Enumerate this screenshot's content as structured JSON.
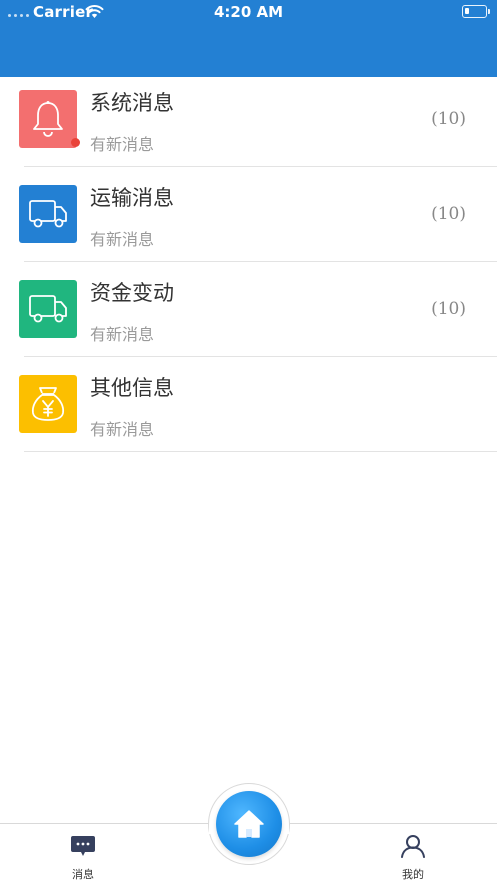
{
  "status_bar": {
    "carrier": "Carrier",
    "time": "4:20 AM"
  },
  "messages": [
    {
      "title": "系统消息",
      "subtitle": "有新消息",
      "count": "(10)",
      "icon": "bell-icon",
      "color": "#f36f6f",
      "unread_dot": true
    },
    {
      "title": "运输消息",
      "subtitle": "有新消息",
      "count": "(10)",
      "icon": "truck-icon",
      "color": "#2380d3",
      "unread_dot": false
    },
    {
      "title": "资金变动",
      "subtitle": "有新消息",
      "count": "(10)",
      "icon": "truck-icon",
      "color": "#20b67f",
      "unread_dot": false
    },
    {
      "title": "其他信息",
      "subtitle": "有新消息",
      "count": "",
      "icon": "money-bag-icon",
      "color": "#fcbf00",
      "unread_dot": false
    }
  ],
  "tabbar": {
    "messages_label": "消息",
    "home_icon": "home-icon",
    "profile_label": "我的"
  },
  "colors": {
    "header": "#2380d3",
    "tab_icon": "#36405e"
  }
}
